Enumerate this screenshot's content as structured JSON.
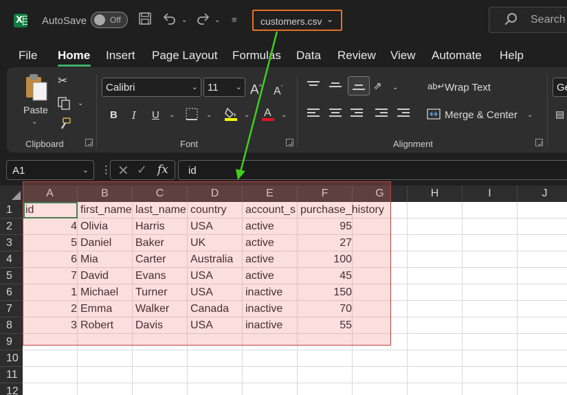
{
  "titlebar": {
    "autosave_label": "AutoSave",
    "autosave_state": "Off",
    "filename": "customers.csv",
    "search_label": "Search"
  },
  "menu": {
    "tabs": [
      "File",
      "Home",
      "Insert",
      "Page Layout",
      "Formulas",
      "Data",
      "Review",
      "View",
      "Automate",
      "Help"
    ],
    "active": "Home"
  },
  "ribbon": {
    "clipboard": {
      "paste_label": "Paste",
      "group_label": "Clipboard"
    },
    "font": {
      "font_name": "Calibri",
      "font_size": "11",
      "bold": "B",
      "italic": "I",
      "underline": "U",
      "group_label": "Font",
      "highlight_color": "#ffff00",
      "font_color": "#e81123"
    },
    "alignment": {
      "wrap_text": "Wrap Text",
      "merge_center": "Merge & Center",
      "group_label": "Alignment"
    },
    "number": {
      "format_truncated": "Ge"
    }
  },
  "formula_bar": {
    "name_box": "A1",
    "fx": "fx",
    "formula": "id"
  },
  "sheet": {
    "columns": [
      "A",
      "B",
      "C",
      "D",
      "E",
      "F",
      "G",
      "H",
      "I",
      "J"
    ],
    "rows": [
      "1",
      "2",
      "3",
      "4",
      "5",
      "6",
      "7",
      "8",
      "9",
      "10",
      "11",
      "12"
    ],
    "header": [
      "id",
      "first_name",
      "last_name",
      "country",
      "account_s",
      "purchase_history"
    ],
    "data": [
      [
        "4",
        "Olivia",
        "Harris",
        "USA",
        "active",
        "95"
      ],
      [
        "5",
        "Daniel",
        "Baker",
        "UK",
        "active",
        "27"
      ],
      [
        "6",
        "Mia",
        "Carter",
        "Australia",
        "active",
        "100"
      ],
      [
        "7",
        "David",
        "Evans",
        "USA",
        "active",
        "45"
      ],
      [
        "1",
        "Michael",
        "Turner",
        "USA",
        "inactive",
        "150"
      ],
      [
        "2",
        "Emma",
        "Walker",
        "Canada",
        "inactive",
        "70"
      ],
      [
        "3",
        "Robert",
        "Davis",
        "USA",
        "inactive",
        "55"
      ]
    ]
  },
  "colors": {
    "accent_green": "#107c41",
    "filename_highlight": "#e87025",
    "annotation_arrow": "#3fd11a"
  }
}
